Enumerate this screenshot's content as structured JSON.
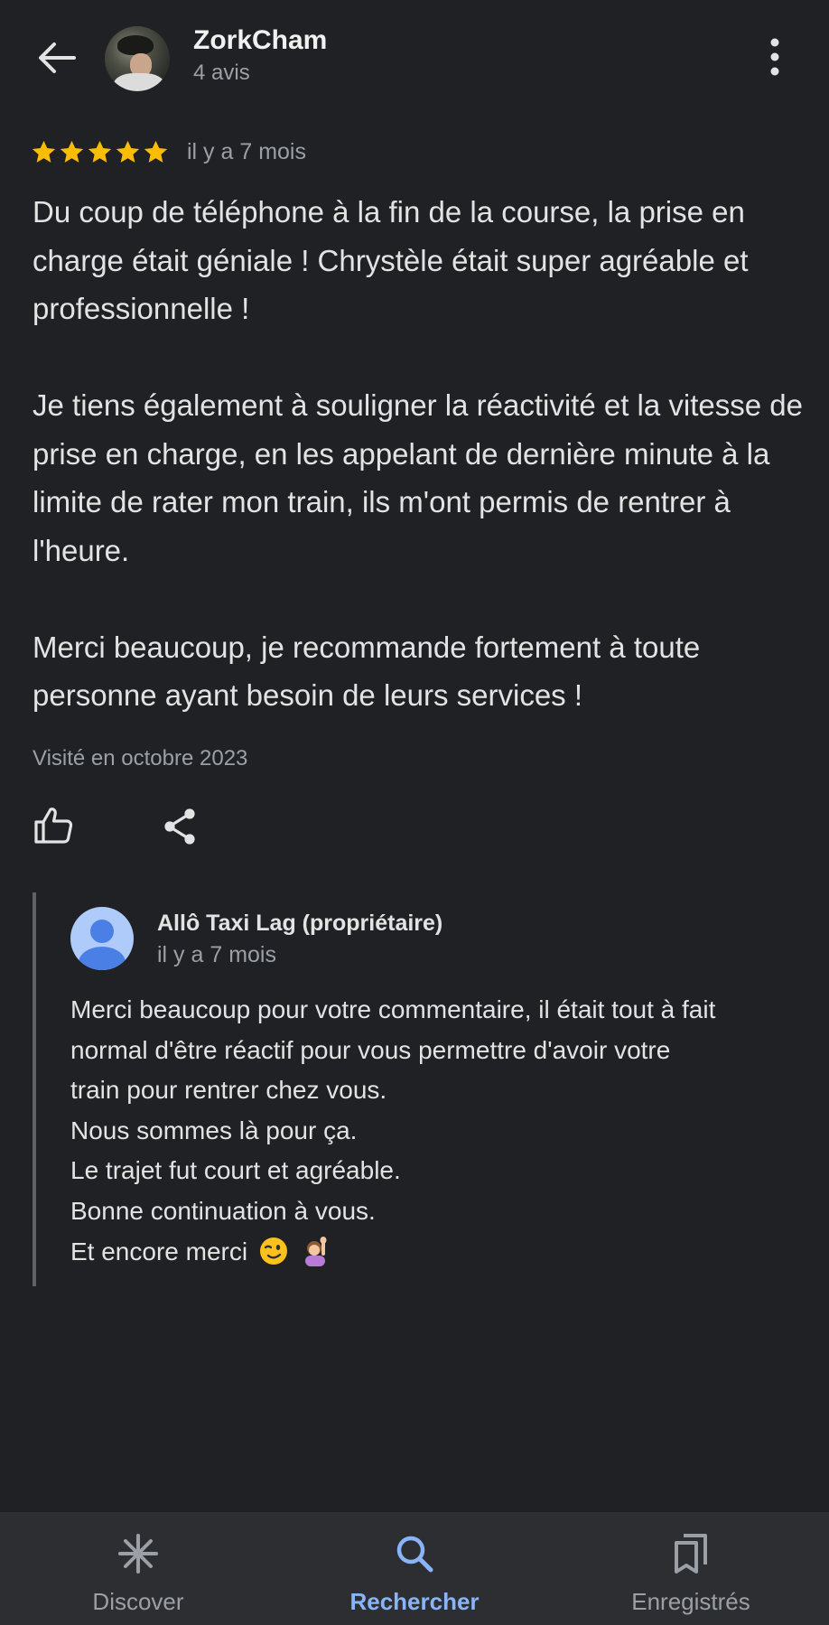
{
  "header": {
    "back_icon": "arrow-back-icon",
    "user_name": "ZorkCham",
    "reviews_count": "4 avis",
    "more_icon": "more-vert-icon"
  },
  "review": {
    "rating": 5,
    "rating_max": 5,
    "star_color": "#fbbc04",
    "date": "il y a 7 mois",
    "paragraphs": [
      "Du coup de téléphone à la fin de la course, la prise en charge était géniale ! Chrystèle était super agréable et professionnelle !",
      "Je tiens également à souligner la réactivité et la vitesse de prise en charge, en les appelant de dernière minute à la limite de rater mon train, ils m'ont permis de rentrer à l'heure.",
      "Merci beaucoup, je recommande fortement à toute personne ayant besoin de leurs services !"
    ],
    "visited": "Visité en octobre 2023",
    "like_icon": "thumb-up-icon",
    "share_icon": "share-icon"
  },
  "owner_reply": {
    "name": "Allô Taxi Lag (propriétaire)",
    "date": "il y a 7 mois",
    "lines": [
      "Merci beaucoup pour votre commentaire, il était tout à fait",
      "normal d'être réactif pour vous permettre d'avoir votre",
      "train pour rentrer chez vous.",
      "Nous sommes là pour ça.",
      "Le trajet fut court et agréable.",
      "Bonne continuation à vous.",
      "Et encore merci"
    ],
    "emojis": [
      "winking-face-emoji",
      "person-raising-hand-emoji"
    ]
  },
  "bottom_nav": {
    "active_color": "#8ab4f8",
    "items": [
      {
        "label": "Discover",
        "icon": "asterisk-icon"
      },
      {
        "label": "Rechercher",
        "icon": "search-icon",
        "active": true
      },
      {
        "label": "Enregistrés",
        "icon": "bookmarks-icon"
      }
    ]
  }
}
